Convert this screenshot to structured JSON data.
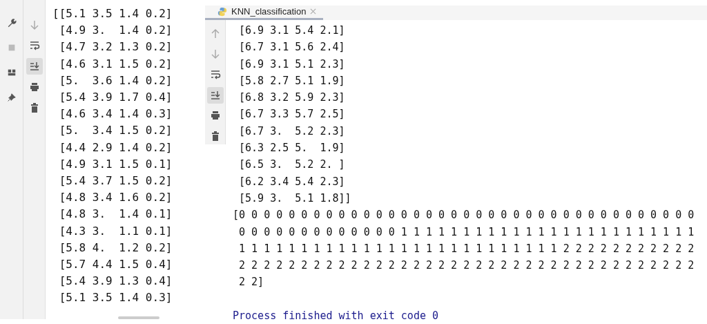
{
  "left_console": {
    "side_strip": [
      {
        "kind": "wrench"
      },
      {
        "kind": "square"
      },
      {
        "kind": "layout"
      },
      {
        "kind": "pin"
      }
    ],
    "toolbar": [
      {
        "kind": "down",
        "selected": false
      },
      {
        "kind": "wrap",
        "selected": false
      },
      {
        "kind": "scroll-end",
        "selected": true
      },
      {
        "kind": "print",
        "selected": false
      },
      {
        "kind": "trash",
        "selected": false
      }
    ],
    "lines": [
      "[[5.1 3.5 1.4 0.2]",
      " [4.9 3.  1.4 0.2]",
      " [4.7 3.2 1.3 0.2]",
      " [4.6 3.1 1.5 0.2]",
      " [5.  3.6 1.4 0.2]",
      " [5.4 3.9 1.7 0.4]",
      " [4.6 3.4 1.4 0.3]",
      " [5.  3.4 1.5 0.2]",
      " [4.4 2.9 1.4 0.2]",
      " [4.9 3.1 1.5 0.1]",
      " [5.4 3.7 1.5 0.2]",
      " [4.8 3.4 1.6 0.2]",
      " [4.8 3.  1.4 0.1]",
      " [4.3 3.  1.1 0.1]",
      " [5.8 4.  1.2 0.2]",
      " [5.7 4.4 1.5 0.4]",
      " [5.4 3.9 1.3 0.4]",
      " [5.1 3.5 1.4 0.3]"
    ]
  },
  "right_console": {
    "tab": {
      "label": "KNN_classification",
      "selected": true
    },
    "toolbar": [
      {
        "kind": "up",
        "selected": false
      },
      {
        "kind": "down",
        "selected": false
      },
      {
        "kind": "wrap",
        "selected": false
      },
      {
        "kind": "scroll-end",
        "selected": true
      },
      {
        "kind": "print",
        "selected": false
      },
      {
        "kind": "trash",
        "selected": false
      }
    ],
    "lines": [
      " [6.9 3.1 5.4 2.1]",
      " [6.7 3.1 5.6 2.4]",
      " [6.9 3.1 5.1 2.3]",
      " [5.8 2.7 5.1 1.9]",
      " [6.8 3.2 5.9 2.3]",
      " [6.7 3.3 5.7 2.5]",
      " [6.7 3.  5.2 2.3]",
      " [6.3 2.5 5.  1.9]",
      " [6.5 3.  5.2 2. ]",
      " [6.2 3.4 5.4 2.3]",
      " [5.9 3.  5.1 1.8]]",
      "[0 0 0 0 0 0 0 0 0 0 0 0 0 0 0 0 0 0 0 0 0 0 0 0 0 0 0 0 0 0 0 0 0 0 0 0 0",
      " 0 0 0 0 0 0 0 0 0 0 0 0 0 1 1 1 1 1 1 1 1 1 1 1 1 1 1 1 1 1 1 1 1 1 1 1 1",
      " 1 1 1 1 1 1 1 1 1 1 1 1 1 1 1 1 1 1 1 1 1 1 1 1 1 1 2 2 2 2 2 2 2 2 2 2 2",
      " 2 2 2 2 2 2 2 2 2 2 2 2 2 2 2 2 2 2 2 2 2 2 2 2 2 2 2 2 2 2 2 2 2 2 2 2 2",
      " 2 2]"
    ],
    "exit_message": "Process finished with exit code 0"
  }
}
